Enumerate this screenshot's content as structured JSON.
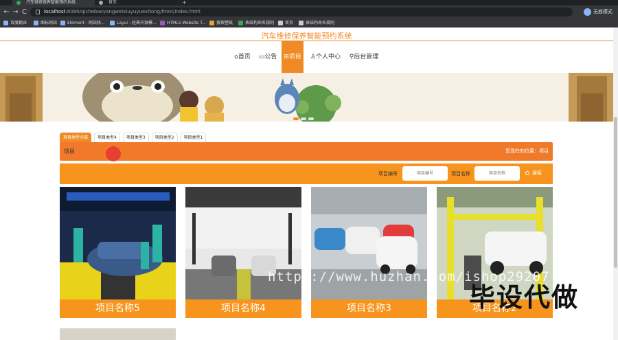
{
  "browser": {
    "tabs": [
      {
        "label": "汽车维修保养智能预约系统"
      },
      {
        "label": "首页"
      }
    ],
    "new_tab": "+",
    "back": "←",
    "forward": "→",
    "reload": "C",
    "url_host": "localhost",
    "url_path": ":8080/qichebaoyangweixiuyuyuexitong/front/index.html",
    "profile_label": "无痕模式",
    "bookmarks": [
      "百度翻译",
      "图标网站",
      "Element - 网站快...",
      "Layui - 经典开源模...",
      "HTML5 Website T...",
      "搜索壁纸",
      "表结构命名规则",
      "首页",
      "表结构命名规则"
    ]
  },
  "site": {
    "title": "汽车维修保养智能预约系统",
    "nav": [
      {
        "label": "⌂首页"
      },
      {
        "label": "▭公告"
      },
      {
        "label": "⊞项目"
      },
      {
        "label": "♙个人中心"
      },
      {
        "label": "⚲后台管理"
      }
    ]
  },
  "categories": [
    "项目类型全部",
    "项目类型4",
    "项目类型3",
    "项目类型2",
    "项目类型1"
  ],
  "breadcrumb": {
    "title": "项目",
    "location": "您现在的位置：项目"
  },
  "search": {
    "field1_label": "项目编号",
    "field1_placeholder": "项目编号",
    "field2_label": "项目名称",
    "field2_placeholder": "项目名称",
    "button_label": "搜索"
  },
  "cards": [
    {
      "name": "项目名称5"
    },
    {
      "name": "项目名称4"
    },
    {
      "name": "项目名称3"
    },
    {
      "name": "项目名称2"
    }
  ],
  "watermark": {
    "url": "https://www.huzhan.com/ishop29207",
    "brand": "毕设代做"
  },
  "colors": {
    "accent": "#f08a24",
    "search_bar": "#f7941d",
    "breadcrumb_bar": "#f07a2a"
  }
}
